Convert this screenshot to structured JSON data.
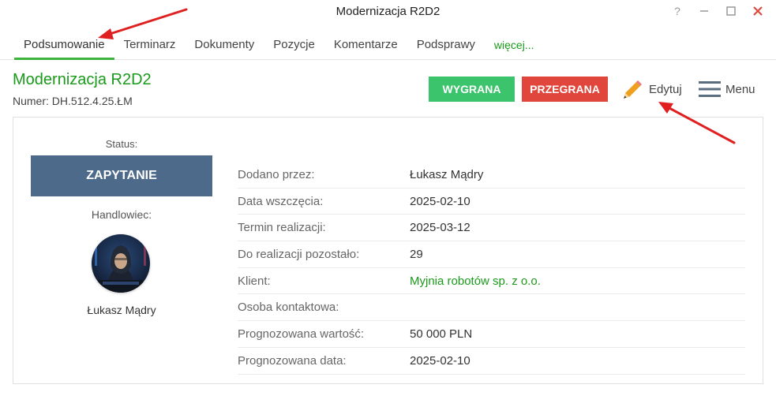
{
  "window": {
    "title": "Modernizacja R2D2"
  },
  "window_controls": {
    "help": "?"
  },
  "tabs": [
    {
      "label": "Podsumowanie"
    },
    {
      "label": "Terminarz"
    },
    {
      "label": "Dokumenty"
    },
    {
      "label": "Pozycje"
    },
    {
      "label": "Komentarze"
    },
    {
      "label": "Podsprawy"
    },
    {
      "label": "więcej..."
    }
  ],
  "header": {
    "title": "Modernizacja R2D2",
    "number": "Numer: DH.512.4.25.ŁM",
    "win_label": "WYGRANA",
    "lose_label": "PRZEGRANA",
    "edit_label": "Edytuj",
    "menu_label": "Menu"
  },
  "left": {
    "status_label": "Status:",
    "status_value": "ZAPYTANIE",
    "sales_label": "Handlowiec:",
    "sales_name": "Łukasz Mądry"
  },
  "details": [
    {
      "key": "Dodano przez:",
      "value": "Łukasz Mądry"
    },
    {
      "key": "Data wszczęcia:",
      "value": "2025-02-10"
    },
    {
      "key": "Termin realizacji:",
      "value": "2025-03-12"
    },
    {
      "key": "Do realizacji pozostało:",
      "value": "29"
    },
    {
      "key": "Klient:",
      "value": "Myjnia robotów sp. z o.o."
    },
    {
      "key": "Osoba kontaktowa:",
      "value": ""
    },
    {
      "key": "Prognozowana wartość:",
      "value": "50 000 PLN"
    },
    {
      "key": "Prognozowana data:",
      "value": "2025-02-10"
    }
  ],
  "colors": {
    "accent_green": "#1a9a1a",
    "win_button": "#3cc46c",
    "lose_button": "#e0463c",
    "status_badge": "#4d6a8a",
    "annotation_arrow": "#e02020"
  }
}
